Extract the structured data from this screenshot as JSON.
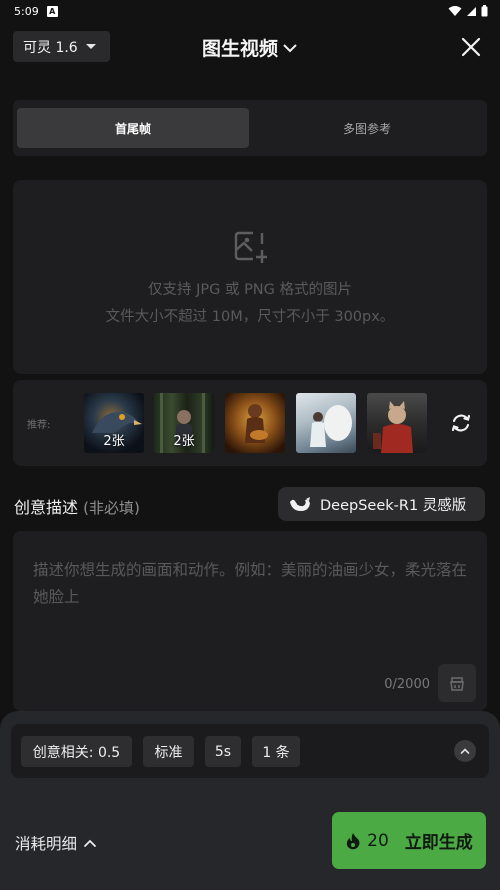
{
  "status_bar": {
    "time": "5:09",
    "a_badge": "A"
  },
  "header": {
    "version_label": "可灵 1.6",
    "title": "图生视频"
  },
  "tabs": [
    {
      "label": "首尾帧",
      "active": true
    },
    {
      "label": "多图参考",
      "active": false
    }
  ],
  "upload": {
    "line1": "仅支持 JPG 或 PNG 格式的图片",
    "line2": "文件大小不超过 10M，尺寸不小于 300px。"
  },
  "recommend": {
    "label": "推荐:",
    "thumbnails": [
      {
        "count_label": "2张",
        "subject": "eagle"
      },
      {
        "count_label": "2张",
        "subject": "child in bamboo forest"
      },
      {
        "count_label": "",
        "subject": "girl playing guitar"
      },
      {
        "count_label": "",
        "subject": "woman with white tiger"
      },
      {
        "count_label": "",
        "subject": "cat in red outfit"
      }
    ]
  },
  "description": {
    "label": "创意描述",
    "optional_label": "(非必填)",
    "ai_button_label": "DeepSeek-R1 灵感版",
    "placeholder": "描述你想生成的画面和动作。例如：美丽的油画少女，柔光落在她脸上",
    "counter": "0/2000"
  },
  "params": [
    {
      "label": "创意相关: 0.5"
    },
    {
      "label": "标准"
    },
    {
      "label": "5s"
    },
    {
      "label": "1 条"
    }
  ],
  "footer": {
    "cost_label": "消耗明细",
    "credits": "20",
    "generate_label": "立即生成"
  },
  "colors": {
    "background": "#121212",
    "panel": "#1e1e20",
    "sheet": "#26272b",
    "accent_green": "#4caa45"
  }
}
